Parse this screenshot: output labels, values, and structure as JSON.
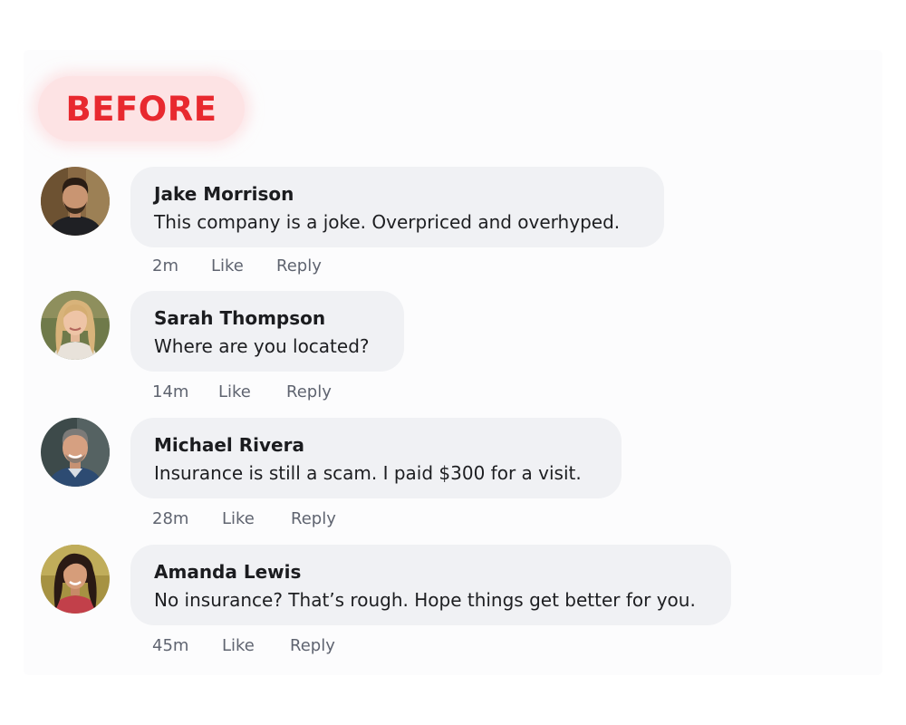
{
  "badge": {
    "label": "BEFORE"
  },
  "colors": {
    "badge_bg": "#fde3e4",
    "badge_text": "#e8292f",
    "bubble_bg": "#f0f1f4",
    "meta_text": "#5f6470"
  },
  "comments": [
    {
      "author": "Jake Morrison",
      "text": "This company is a joke. Overpriced and overhyped.",
      "time": "2m",
      "like": "Like",
      "reply": "Reply",
      "avatar_icon": "man-dark-hair-beard-avatar"
    },
    {
      "author": "Sarah Thompson",
      "text": "Where are you located?",
      "time": "14m",
      "like": "Like",
      "reply": "Reply",
      "avatar_icon": "woman-blonde-hair-avatar"
    },
    {
      "author": "Michael Rivera",
      "text": "Insurance is still a scam. I paid $300 for a visit.",
      "time": "28m",
      "like": "Like",
      "reply": "Reply",
      "avatar_icon": "man-gray-hair-avatar"
    },
    {
      "author": "Amanda Lewis",
      "text": "No insurance? That’s rough. Hope things get better for you.",
      "time": "45m",
      "like": "Like",
      "reply": "Reply",
      "avatar_icon": "woman-dark-hair-avatar"
    }
  ]
}
